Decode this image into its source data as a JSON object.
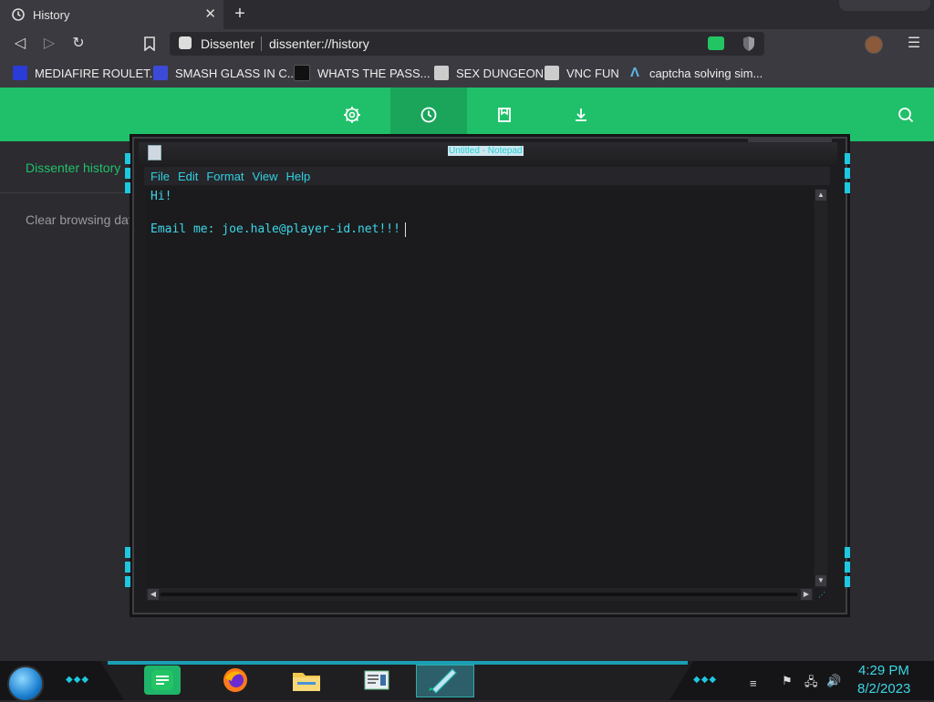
{
  "browser": {
    "tab_title": "History",
    "url_site": "Dissenter",
    "url": "dissenter://history",
    "bookmarks": [
      {
        "label": "MEDIAFIRE ROULET...",
        "icon": "mediafire-icon",
        "color": "#2a3bd6"
      },
      {
        "label": "SMASH GLASS IN C...",
        "icon": "chevron-logo-icon",
        "color": "#3b4bd8"
      },
      {
        "label": "WHATS THE PASS...",
        "icon": "terminal-icon",
        "color": "#111111"
      },
      {
        "label": "SEX DUNGEON",
        "icon": "cube-icon",
        "color": "#cccccc"
      },
      {
        "label": "VNC FUN",
        "icon": "cube-icon",
        "color": "#cccccc"
      },
      {
        "label": "captcha solving sim...",
        "icon": "a-logo-icon",
        "color": "#5fb6e8"
      }
    ]
  },
  "dissenter": {
    "accent": "#20c06a",
    "nav_icons": [
      "gear-icon",
      "history-icon",
      "bookmark-icon",
      "download-icon"
    ],
    "sidebar": {
      "history_label": "Dissenter history",
      "clear_label": "Clear browsing data"
    }
  },
  "notepad": {
    "title": "Untitled - Notepad",
    "menu": [
      "File",
      "Edit",
      "Format",
      "View",
      "Help"
    ],
    "lines": [
      "Hi!",
      "",
      "Email me: joe.hale@player-id.net!!!"
    ]
  },
  "taskbar": {
    "apps": [
      "notes-app-icon",
      "firefox-icon",
      "file-explorer-icon",
      "notepad-app-icon",
      "pen-tool-icon"
    ],
    "clock_time": "4:29 PM",
    "clock_date": "8/2/2023"
  }
}
